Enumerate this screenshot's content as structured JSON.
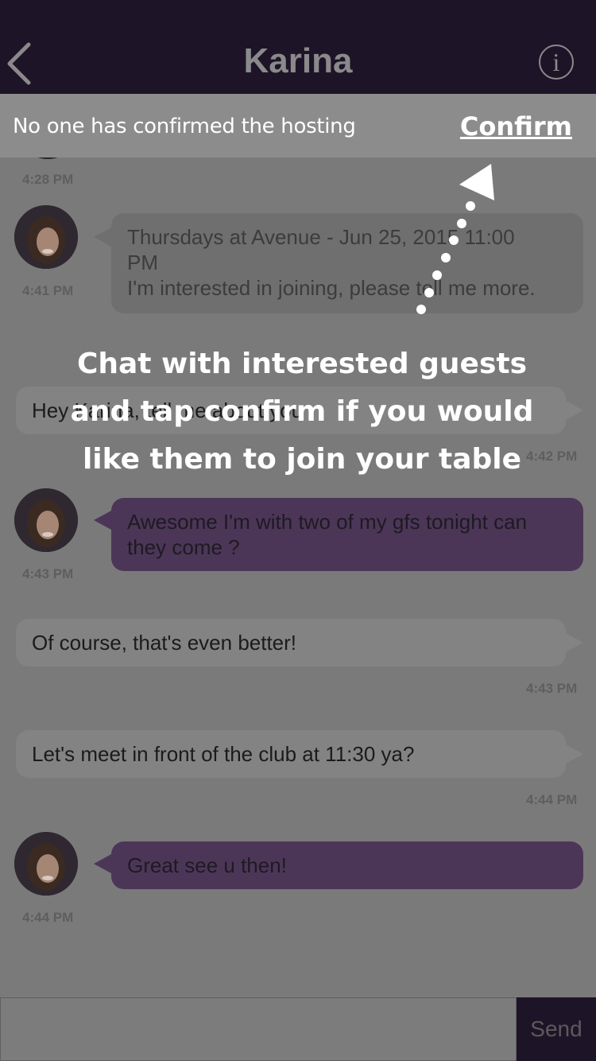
{
  "header": {
    "title": "Karina",
    "back_icon": "chevron-left-icon",
    "info_icon": "info-icon",
    "info_glyph": "i"
  },
  "banner": {
    "text": "No one has confirmed the hosting",
    "link": "Confirm"
  },
  "messages": [
    {
      "time": "4:28 PM"
    },
    {
      "side": "left",
      "style": "grey",
      "text_line1": "Thursdays at Avenue - Jun 25, 2015 11:00",
      "text_line2": "PM",
      "text_line3": "I'm interested in joining, please tell me more.",
      "time": "4:41 PM"
    },
    {
      "side": "right",
      "text": "Hey Karina, tell me about you",
      "time": "4:42 PM"
    },
    {
      "side": "left",
      "style": "purple",
      "text": "Awesome I'm with two of my gfs tonight can they come ?",
      "time": "4:43 PM"
    },
    {
      "side": "right",
      "text": "Of course, that's even better!",
      "time": "4:43 PM"
    },
    {
      "side": "right",
      "text": "Let's meet in front of the club at 11:30 ya?",
      "time": "4:44 PM"
    },
    {
      "side": "left",
      "style": "purple",
      "text": "Great see u then!",
      "time": "4:44 PM"
    }
  ],
  "composer": {
    "placeholder": "",
    "send_label": "Send"
  },
  "overlay": {
    "hint_line1": "Chat with interested guests",
    "hint_line2": "and tap confirm if you would",
    "hint_line3": "like them to join your table"
  },
  "colors": {
    "nav_bg": "#1e1428",
    "purple_bubble": "#4c3658",
    "overlay_text": "#ffffff"
  }
}
